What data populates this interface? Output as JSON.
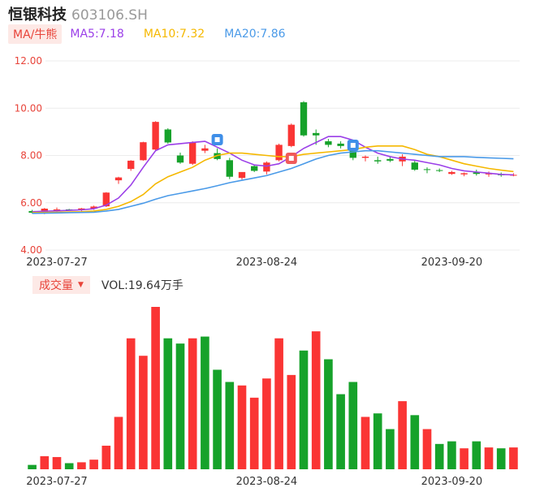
{
  "header": {
    "name": "恒银科技",
    "code": "603106.SH"
  },
  "ma_legend": {
    "tag": "MA/牛熊",
    "items": [
      {
        "label": "MA5:7.18",
        "color": "#9b3fe8"
      },
      {
        "label": "MA10:7.32",
        "color": "#f5b800"
      },
      {
        "label": "MA20:7.86",
        "color": "#4a9ae8"
      }
    ]
  },
  "volume_legend": {
    "tag": "成交量",
    "arrow": "▼",
    "text": "VOL:19.64万手"
  },
  "colors": {
    "up": "#fa3534",
    "down": "#16a22a",
    "axis_text": "#e8443a"
  },
  "chart_data": [
    {
      "type": "candlestick",
      "title": "",
      "ylim": [
        4.0,
        12.0
      ],
      "yticks": [
        "12.00",
        "10.00",
        "8.00",
        "6.00",
        "4.00"
      ],
      "date_labels": [
        {
          "index": 2,
          "label": "2023-07-27"
        },
        {
          "index": 19,
          "label": "2023-08-24"
        },
        {
          "index": 34,
          "label": "2023-09-20"
        }
      ],
      "ohlc": [
        [
          5.65,
          5.7,
          5.55,
          5.58
        ],
        [
          5.6,
          5.78,
          5.52,
          5.75
        ],
        [
          5.68,
          5.8,
          5.62,
          5.72
        ],
        [
          5.72,
          5.74,
          5.66,
          5.68
        ],
        [
          5.7,
          5.78,
          5.65,
          5.76
        ],
        [
          5.75,
          5.88,
          5.7,
          5.84
        ],
        [
          5.85,
          6.45,
          5.82,
          6.43
        ],
        [
          6.95,
          7.1,
          6.8,
          7.07
        ],
        [
          7.43,
          7.8,
          7.35,
          7.78
        ],
        [
          7.8,
          8.58,
          7.78,
          8.56
        ],
        [
          8.25,
          9.45,
          8.2,
          9.42
        ],
        [
          9.1,
          9.15,
          8.5,
          8.55
        ],
        [
          8.0,
          8.12,
          7.65,
          7.7
        ],
        [
          7.65,
          8.6,
          7.6,
          8.55
        ],
        [
          8.2,
          8.45,
          8.1,
          8.3
        ],
        [
          8.1,
          8.3,
          7.8,
          7.85
        ],
        [
          7.8,
          7.9,
          7.0,
          7.1
        ],
        [
          7.05,
          7.25,
          6.98,
          7.3
        ],
        [
          7.55,
          7.6,
          7.3,
          7.35
        ],
        [
          7.32,
          7.75,
          7.2,
          7.7
        ],
        [
          7.8,
          8.5,
          7.75,
          8.45
        ],
        [
          8.4,
          9.35,
          8.35,
          9.3
        ],
        [
          10.25,
          10.3,
          8.8,
          8.85
        ],
        [
          8.95,
          9.1,
          8.45,
          8.85
        ],
        [
          8.6,
          8.7,
          8.35,
          8.45
        ],
        [
          8.5,
          8.6,
          8.3,
          8.4
        ],
        [
          8.4,
          8.55,
          7.8,
          7.9
        ],
        [
          7.9,
          8.0,
          7.75,
          7.95
        ],
        [
          7.8,
          7.95,
          7.65,
          7.75
        ],
        [
          7.85,
          7.95,
          7.72,
          7.78
        ],
        [
          7.75,
          8.05,
          7.55,
          7.95
        ],
        [
          7.7,
          7.8,
          7.35,
          7.4
        ],
        [
          7.42,
          7.5,
          7.25,
          7.4
        ],
        [
          7.38,
          7.45,
          7.3,
          7.35
        ],
        [
          7.22,
          7.35,
          7.18,
          7.3
        ],
        [
          7.2,
          7.28,
          7.12,
          7.25
        ],
        [
          7.28,
          7.4,
          7.15,
          7.22
        ],
        [
          7.2,
          7.32,
          7.1,
          7.25
        ],
        [
          7.2,
          7.28,
          7.1,
          7.18
        ],
        [
          7.15,
          7.25,
          7.12,
          7.18
        ]
      ],
      "ma5": [
        5.62,
        5.64,
        5.66,
        5.68,
        5.7,
        5.75,
        5.9,
        6.2,
        6.75,
        7.5,
        8.2,
        8.45,
        8.5,
        8.55,
        8.6,
        8.35,
        8.1,
        7.8,
        7.6,
        7.55,
        7.65,
        7.95,
        8.3,
        8.55,
        8.8,
        8.8,
        8.65,
        8.35,
        8.1,
        7.95,
        7.85,
        7.8,
        7.7,
        7.6,
        7.45,
        7.35,
        7.3,
        7.25,
        7.2,
        7.18
      ],
      "ma10": [
        5.58,
        5.59,
        5.6,
        5.61,
        5.62,
        5.65,
        5.72,
        5.85,
        6.05,
        6.35,
        6.8,
        7.1,
        7.3,
        7.5,
        7.8,
        8.0,
        8.1,
        8.1,
        8.05,
        8.0,
        7.95,
        7.95,
        8.05,
        8.1,
        8.15,
        8.2,
        8.25,
        8.35,
        8.4,
        8.4,
        8.4,
        8.25,
        8.05,
        7.95,
        7.8,
        7.65,
        7.55,
        7.45,
        7.38,
        7.32
      ],
      "ma20": [
        5.55,
        5.56,
        5.57,
        5.58,
        5.59,
        5.6,
        5.65,
        5.72,
        5.85,
        5.98,
        6.15,
        6.3,
        6.4,
        6.5,
        6.6,
        6.72,
        6.85,
        6.95,
        7.05,
        7.15,
        7.3,
        7.45,
        7.65,
        7.85,
        8.0,
        8.1,
        8.15,
        8.2,
        8.2,
        8.15,
        8.1,
        8.05,
        8.0,
        7.95,
        7.95,
        7.95,
        7.92,
        7.9,
        7.88,
        7.86
      ]
    },
    {
      "type": "bar",
      "title": "",
      "name": "成交量",
      "values": [
        2.5,
        7.5,
        7.0,
        3.5,
        4.0,
        5.5,
        13.5,
        30.0,
        75.0,
        65.0,
        93.0,
        75.0,
        72.0,
        75.0,
        76.0,
        57.0,
        50.0,
        48.0,
        41.0,
        52.0,
        75.0,
        54.0,
        68.0,
        79.0,
        63.0,
        43.0,
        50.0,
        30.0,
        32.0,
        23.0,
        39.0,
        31.0,
        23.0,
        14.5,
        16.0,
        12.0,
        16.0,
        12.5,
        12.0,
        12.5
      ],
      "directions": [
        "down",
        "up",
        "up",
        "down",
        "up",
        "up",
        "up",
        "up",
        "up",
        "up",
        "up",
        "down",
        "down",
        "up",
        "down",
        "down",
        "down",
        "up",
        "up",
        "up",
        "up",
        "up",
        "down",
        "up",
        "down",
        "down",
        "down",
        "up",
        "down",
        "down",
        "up",
        "down",
        "up",
        "down",
        "down",
        "up",
        "down",
        "up",
        "down",
        "up"
      ]
    }
  ]
}
